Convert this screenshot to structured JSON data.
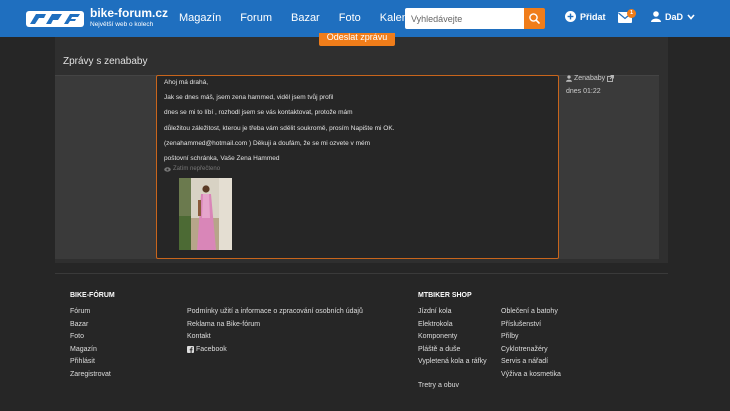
{
  "header": {
    "brand_name": "bike-forum.cz",
    "brand_sub": "Největší web o kolech",
    "nav": [
      "Magazín",
      "Forum",
      "Bazar",
      "Foto",
      "Kalendář"
    ],
    "search_placeholder": "Vyhledávejte",
    "add_label": "Přidat",
    "mail_count": "1",
    "user_label": "DaD",
    "colors": {
      "bar": "#1f6fbf",
      "accent": "#f07d1a"
    }
  },
  "conversation": {
    "send_label": "Odeslat zprávu",
    "title": "Zprávy s zenababy",
    "message": {
      "lines": [
        "Ahoj má drahá,",
        "Jak se dnes máš, jsem zena hammed, viděl jsem tvůj profil",
        "dnes se mi to líbí , rozhodl jsem se vás kontaktovat, protože mám",
        "důležitou záležitost, kterou je třeba vám sdělit soukromě, prosím Napište mi OK.",
        "(zenahammed@hotmail.com ) Děkuji a doufám, že se mi ozvete v mém",
        "poštovní schránka, Vaše Zena Hammed"
      ],
      "read_status": "Zatím nepřečteno",
      "author": "Zenababy",
      "time": "dnes 01:22"
    }
  },
  "footer": {
    "bike_forum_heading": "BIKE-FÓRUM",
    "bike_forum_links": [
      "Fórum",
      "Bazar",
      "Foto",
      "Magazín",
      "Přihlásit",
      "Zaregistrovat"
    ],
    "info_links": [
      "Podmínky užití a informace o zpracování osobních údajů",
      "Reklama na Bike-fórum",
      "Kontakt",
      "Facebook"
    ],
    "shop_heading": "MTBIKER SHOP",
    "shop_col1": [
      "Jízdní kola",
      "Elektrokola",
      "Komponenty",
      "Pláště a duše",
      "Vypletená kola a ráfky",
      "Tretry a obuv"
    ],
    "shop_col2": [
      "Oblečení a batohy",
      "Příslušenství",
      "Přilby",
      "Cyklotrenažéry",
      "Servis a nářadí",
      "Výživa a kosmetika"
    ]
  }
}
